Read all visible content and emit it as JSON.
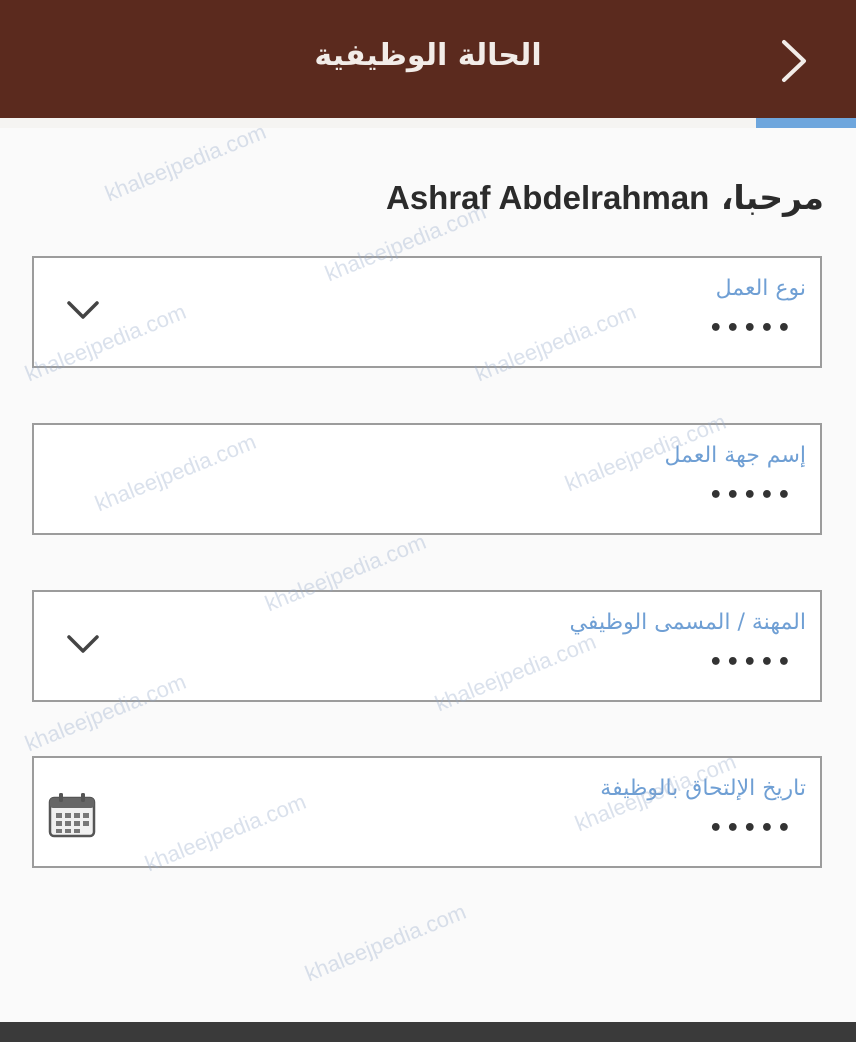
{
  "header": {
    "title": "الحالة الوظيفية"
  },
  "welcome": {
    "greeting": "مرحبا،",
    "name": "Ashraf Abdelrahman"
  },
  "form": {
    "fields": [
      {
        "label": "نوع العمل",
        "value": "•••••",
        "control": "dropdown"
      },
      {
        "label": "إسم جهة العمل",
        "value": "•••••",
        "control": "text"
      },
      {
        "label": "المهنة / المسمى الوظيفي",
        "value": "•••••",
        "control": "dropdown"
      },
      {
        "label": "تاريخ الإلتحاق بالوظيفة",
        "value": "•••••",
        "control": "date"
      }
    ]
  },
  "watermark": {
    "text": "khaleejpedia.com"
  },
  "colors": {
    "header_bg": "#5b2a1e",
    "label_blue": "#6f9fd4",
    "accent_bar": "#6ea6dd"
  },
  "icons": {
    "back": "chevron-right-icon",
    "dropdown": "chevron-down-icon",
    "date": "calendar-icon"
  }
}
